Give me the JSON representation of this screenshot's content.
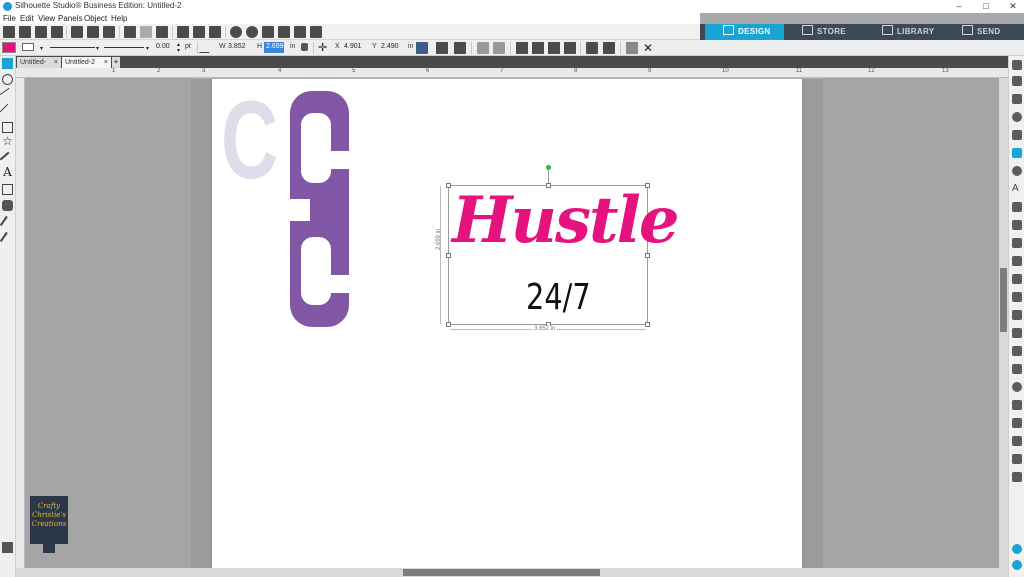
{
  "window": {
    "title": "Silhouette Studio® Business Edition: Untitled-2",
    "minimize": "–",
    "maximize": "□",
    "close": "✕"
  },
  "menu": [
    "File",
    "Edit",
    "View",
    "Panels",
    "Object",
    "Help"
  ],
  "tabs": [
    {
      "label": "DESIGN",
      "icon": "grid-icon",
      "active": true
    },
    {
      "label": "STORE",
      "icon": "store-icon"
    },
    {
      "label": "LIBRARY",
      "icon": "library-icon"
    },
    {
      "label": "SEND",
      "icon": "send-icon"
    }
  ],
  "toolbar2": {
    "line_width": "0.00",
    "line_unit": "pt",
    "w_label": "W",
    "w_value": "3.852",
    "h_label": "H",
    "h_value": "2.699",
    "unit": "in",
    "x_label": "X",
    "x_value": "4.901",
    "y_label": "Y",
    "y_value": "2.490",
    "y_unit": "in",
    "fill_color": "#e5137e"
  },
  "doc_tabs": [
    {
      "label": "Untitled-1",
      "close": "×"
    },
    {
      "label": "Untitled-2",
      "close": "×",
      "active": true
    }
  ],
  "doc_tab_add": "+",
  "ruler": {
    "h_ticks": [
      "1",
      "2",
      "3",
      "4",
      "5",
      "6",
      "7",
      "8",
      "9",
      "10",
      "11",
      "12",
      "13"
    ]
  },
  "design": {
    "letter_faded": "C",
    "letter_top": "C",
    "letter_bottom": "C",
    "faded_color": "#e1dcea",
    "purple_color": "#8257a5",
    "word": "Hustle",
    "word_color": "#e5137e",
    "subtext": "24/7",
    "height_dim": "2.699 in",
    "width_dim": "3.852 in"
  },
  "logo": {
    "line1": "Crafty",
    "line2": "Christie's",
    "line3": "Creations"
  }
}
